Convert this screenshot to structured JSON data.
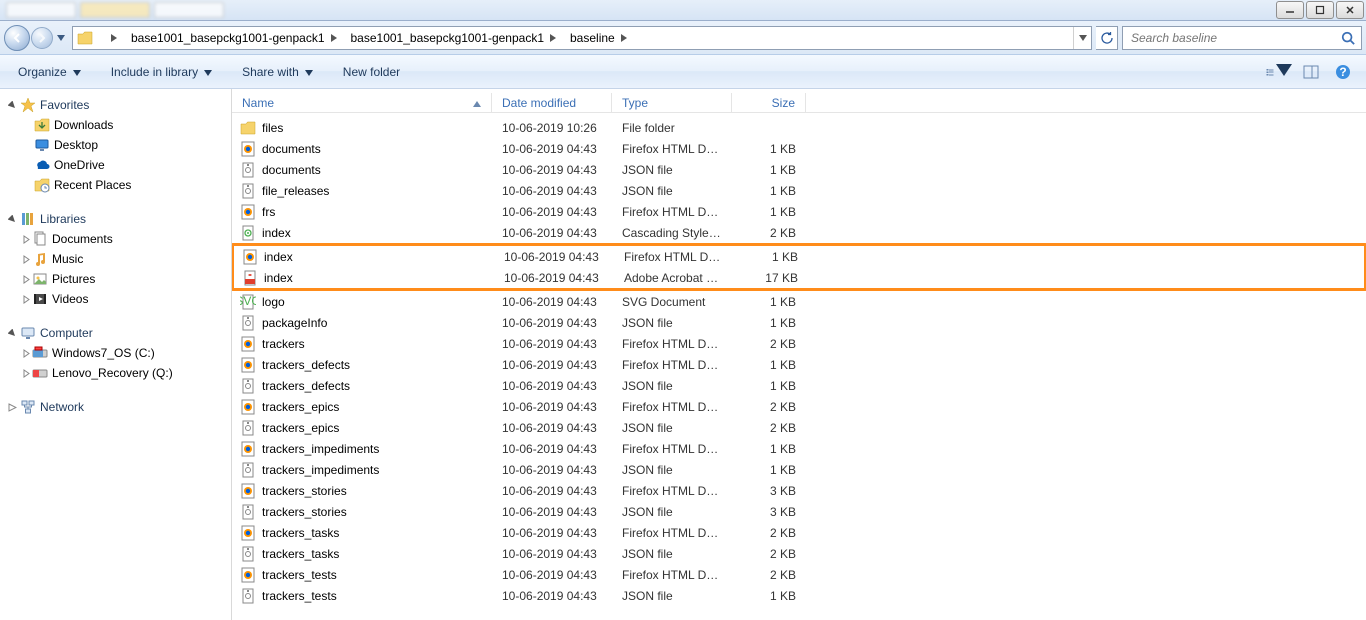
{
  "window": {
    "min": "_",
    "max": "☐",
    "close": "✕"
  },
  "breadcrumbs": [
    "base1001_basepckg1001-genpack1",
    "base1001_basepckg1001-genpack1",
    "baseline"
  ],
  "search": {
    "placeholder": "Search baseline"
  },
  "toolbar": {
    "organize": "Organize",
    "include": "Include in library",
    "share": "Share with",
    "newfolder": "New folder"
  },
  "nav": {
    "favorites": {
      "label": "Favorites",
      "items": [
        "Downloads",
        "Desktop",
        "OneDrive",
        "Recent Places"
      ]
    },
    "libraries": {
      "label": "Libraries",
      "items": [
        "Documents",
        "Music",
        "Pictures",
        "Videos"
      ]
    },
    "computer": {
      "label": "Computer",
      "items": [
        "Windows7_OS (C:)",
        "Lenovo_Recovery (Q:)"
      ]
    },
    "network": {
      "label": "Network"
    }
  },
  "columns": {
    "name": "Name",
    "date": "Date modified",
    "type": "Type",
    "size": "Size"
  },
  "files": [
    {
      "icon": "folder",
      "name": "files",
      "date": "10-06-2019 10:26",
      "type": "File folder",
      "size": ""
    },
    {
      "icon": "firefox",
      "name": "documents",
      "date": "10-06-2019 04:43",
      "type": "Firefox HTML Doc...",
      "size": "1 KB"
    },
    {
      "icon": "json",
      "name": "documents",
      "date": "10-06-2019 04:43",
      "type": "JSON file",
      "size": "1 KB"
    },
    {
      "icon": "json",
      "name": "file_releases",
      "date": "10-06-2019 04:43",
      "type": "JSON file",
      "size": "1 KB"
    },
    {
      "icon": "firefox",
      "name": "frs",
      "date": "10-06-2019 04:43",
      "type": "Firefox HTML Doc...",
      "size": "1 KB"
    },
    {
      "icon": "css",
      "name": "index",
      "date": "10-06-2019 04:43",
      "type": "Cascading Stylesh...",
      "size": "2 KB"
    },
    {
      "icon": "firefox",
      "name": "index",
      "date": "10-06-2019 04:43",
      "type": "Firefox HTML Doc...",
      "size": "1 KB",
      "hl": true
    },
    {
      "icon": "pdf",
      "name": "index",
      "date": "10-06-2019 04:43",
      "type": "Adobe Acrobat D...",
      "size": "17 KB",
      "hl": true
    },
    {
      "icon": "svg",
      "name": "logo",
      "date": "10-06-2019 04:43",
      "type": "SVG Document",
      "size": "1 KB"
    },
    {
      "icon": "json",
      "name": "packageInfo",
      "date": "10-06-2019 04:43",
      "type": "JSON file",
      "size": "1 KB"
    },
    {
      "icon": "firefox",
      "name": "trackers",
      "date": "10-06-2019 04:43",
      "type": "Firefox HTML Doc...",
      "size": "2 KB"
    },
    {
      "icon": "firefox",
      "name": "trackers_defects",
      "date": "10-06-2019 04:43",
      "type": "Firefox HTML Doc...",
      "size": "1 KB"
    },
    {
      "icon": "json",
      "name": "trackers_defects",
      "date": "10-06-2019 04:43",
      "type": "JSON file",
      "size": "1 KB"
    },
    {
      "icon": "firefox",
      "name": "trackers_epics",
      "date": "10-06-2019 04:43",
      "type": "Firefox HTML Doc...",
      "size": "2 KB"
    },
    {
      "icon": "json",
      "name": "trackers_epics",
      "date": "10-06-2019 04:43",
      "type": "JSON file",
      "size": "2 KB"
    },
    {
      "icon": "firefox",
      "name": "trackers_impediments",
      "date": "10-06-2019 04:43",
      "type": "Firefox HTML Doc...",
      "size": "1 KB"
    },
    {
      "icon": "json",
      "name": "trackers_impediments",
      "date": "10-06-2019 04:43",
      "type": "JSON file",
      "size": "1 KB"
    },
    {
      "icon": "firefox",
      "name": "trackers_stories",
      "date": "10-06-2019 04:43",
      "type": "Firefox HTML Doc...",
      "size": "3 KB"
    },
    {
      "icon": "json",
      "name": "trackers_stories",
      "date": "10-06-2019 04:43",
      "type": "JSON file",
      "size": "3 KB"
    },
    {
      "icon": "firefox",
      "name": "trackers_tasks",
      "date": "10-06-2019 04:43",
      "type": "Firefox HTML Doc...",
      "size": "2 KB"
    },
    {
      "icon": "json",
      "name": "trackers_tasks",
      "date": "10-06-2019 04:43",
      "type": "JSON file",
      "size": "2 KB"
    },
    {
      "icon": "firefox",
      "name": "trackers_tests",
      "date": "10-06-2019 04:43",
      "type": "Firefox HTML Doc...",
      "size": "2 KB"
    },
    {
      "icon": "json",
      "name": "trackers_tests",
      "date": "10-06-2019 04:43",
      "type": "JSON file",
      "size": "1 KB"
    }
  ]
}
